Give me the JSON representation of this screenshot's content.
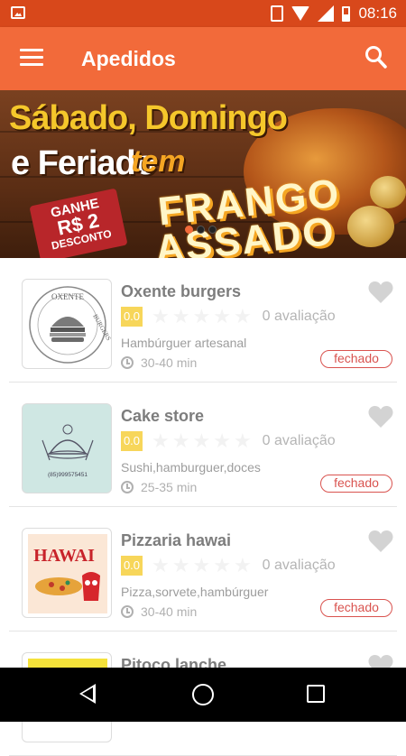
{
  "status_bar": {
    "time": "08:16"
  },
  "app_bar": {
    "title": "Apedidos"
  },
  "banner": {
    "line1": "Sábado, Domingo",
    "line2": "e Feriado",
    "line2_accent": "tem",
    "headline1": "FRANGO",
    "headline2": "ASSADO",
    "tag_line1": "GANHE",
    "tag_line2": "R$ 2",
    "tag_line3": "DESCONTO",
    "page_count": 3,
    "active_page": 1
  },
  "restaurants": [
    {
      "name": "Oxente burgers",
      "score": "0.0",
      "reviews": "0 avaliação",
      "categories": "Hambúrguer artesanal",
      "delivery_time": "30-40 min",
      "status": "fechado",
      "stars": 0
    },
    {
      "name": "Cake store",
      "score": "0.0",
      "reviews": "0 avaliação",
      "categories": "Sushi,hamburguer,doces",
      "delivery_time": "25-35 min",
      "status": "fechado",
      "stars": 0
    },
    {
      "name": "Pizzaria hawai",
      "score": "0.0",
      "reviews": "0 avaliação",
      "categories": "Pizza,sorvete,hambúrguer",
      "delivery_time": "30-40 min",
      "status": "fechado",
      "stars": 0
    },
    {
      "name": "Pitoco lanche"
    }
  ],
  "logos": {
    "oxente": {
      "text_top": "OXENTE",
      "text_side": "BURGERS"
    },
    "cake": {
      "phone": "(85)999575451"
    },
    "hawai": {
      "text": "HAWAI"
    }
  },
  "colors": {
    "primary": "#f26a3a",
    "status_bar": "#d8481b",
    "closed": "#d9534f",
    "score_bg": "#f7d65a"
  }
}
